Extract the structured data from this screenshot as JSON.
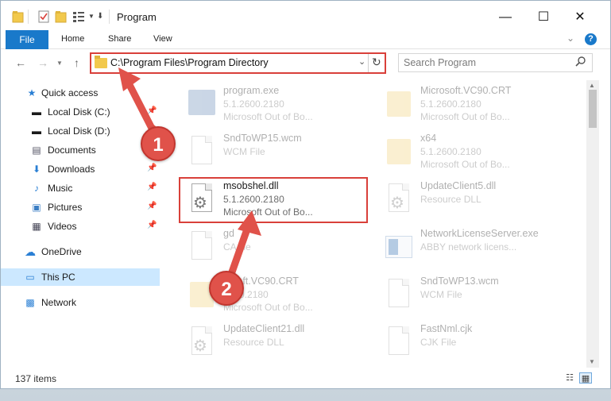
{
  "window": {
    "title": "Program",
    "minimize_icon": "minimize-icon",
    "maximize_icon": "maximize-icon",
    "close_icon": "close-icon"
  },
  "ribbon": {
    "file_label": "File",
    "tabs": [
      "Home",
      "Share",
      "View"
    ],
    "help_label": "?"
  },
  "address": {
    "path": "C:\\Program Files\\Program Directory"
  },
  "search": {
    "placeholder": "Search Program"
  },
  "sidebar": {
    "items": [
      {
        "label": "Quick access",
        "icon": "star-icon",
        "pinned": false
      },
      {
        "label": "Local Disk (C:)",
        "icon": "drive-icon",
        "pinned": true
      },
      {
        "label": "Local Disk (D:)",
        "icon": "drive-icon",
        "pinned": true
      },
      {
        "label": "Documents",
        "icon": "documents-icon",
        "pinned": true
      },
      {
        "label": "Downloads",
        "icon": "download-icon",
        "pinned": true
      },
      {
        "label": "Music",
        "icon": "music-icon",
        "pinned": true
      },
      {
        "label": "Pictures",
        "icon": "pictures-icon",
        "pinned": true
      },
      {
        "label": "Videos",
        "icon": "videos-icon",
        "pinned": true
      },
      {
        "label": "OneDrive",
        "icon": "cloud-icon",
        "pinned": false
      },
      {
        "label": "This PC",
        "icon": "computer-icon",
        "pinned": false,
        "selected": true
      },
      {
        "label": "Network",
        "icon": "network-icon",
        "pinned": false
      }
    ]
  },
  "files": [
    {
      "name": "program.exe",
      "line1": "5.1.2600.2180",
      "line2": "Microsoft Out of Bo...",
      "icon": "exe-icon"
    },
    {
      "name": "Microsoft.VC90.CRT",
      "line1": "5.1.2600.2180",
      "line2": "Microsoft Out of Bo...",
      "icon": "folder-icon"
    },
    {
      "name": "SndToWP15.wcm",
      "line1": "WCM File",
      "line2": "",
      "icon": "document-icon"
    },
    {
      "name": "x64",
      "line1": "5.1.2600.2180",
      "line2": "Microsoft Out of Bo...",
      "icon": "folder-icon"
    },
    {
      "name": "msobshel.dll",
      "line1": "5.1.2600.2180",
      "line2": "Microsoft Out of Bo...",
      "icon": "dll-gear-icon"
    },
    {
      "name": "UpdateClient5.dll",
      "line1": "Resource DLL",
      "line2": "",
      "icon": "dll-gear-icon"
    },
    {
      "name": "gd",
      "line1": "CA file",
      "line2": "",
      "icon": "document-icon"
    },
    {
      "name": "NetworkLicenseServer.exe",
      "line1": "ABBY network licens...",
      "line2": "",
      "icon": "window-icon"
    },
    {
      "name": "rosoft.VC90.CRT",
      "line1": "2600.2180",
      "line2": "Microsoft Out of Bo...",
      "icon": "folder-icon"
    },
    {
      "name": "SndToWP13.wcm",
      "line1": "WCM File",
      "line2": "",
      "icon": "document-icon"
    },
    {
      "name": "UpdateClient21.dll",
      "line1": "Resource DLL",
      "line2": "",
      "icon": "dll-gear-icon"
    },
    {
      "name": "FastNml.cjk",
      "line1": "CJK File",
      "line2": "",
      "icon": "document-icon"
    }
  ],
  "callouts": [
    "1",
    "2"
  ],
  "status": {
    "items_count": "137 items"
  },
  "colors": {
    "accent": "#1979ca",
    "highlight": "#d9403a",
    "selected": "#cce8ff"
  }
}
